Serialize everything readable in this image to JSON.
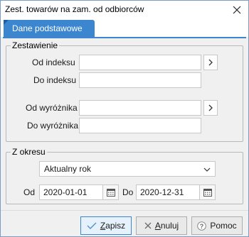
{
  "window": {
    "title": "Zest. towarów na zam. od odbiorców"
  },
  "tabs": [
    {
      "label": "Dane podstawowe"
    }
  ],
  "zestawienie": {
    "legend": "Zestawienie",
    "od_indeksu": {
      "label": "Od indeksu",
      "value": ""
    },
    "do_indeksu": {
      "label": "Do indeksu",
      "value": ""
    },
    "od_wyroznika": {
      "label": "Od wyróżnika",
      "value": ""
    },
    "do_wyroznika": {
      "label": "Do wyróżnika",
      "value": ""
    }
  },
  "okres": {
    "legend": "Z okresu",
    "period_select": {
      "value": "Aktualny rok"
    },
    "od": {
      "label": "Od",
      "value": "2020-01-01"
    },
    "do": {
      "label": "Do",
      "value": "2020-12-31"
    }
  },
  "footer": {
    "save": {
      "label_first": "Z",
      "label_rest": "apisz"
    },
    "cancel": {
      "label_first": "A",
      "label_rest": "nuluj"
    },
    "help": {
      "label": "Pomoc"
    }
  }
}
